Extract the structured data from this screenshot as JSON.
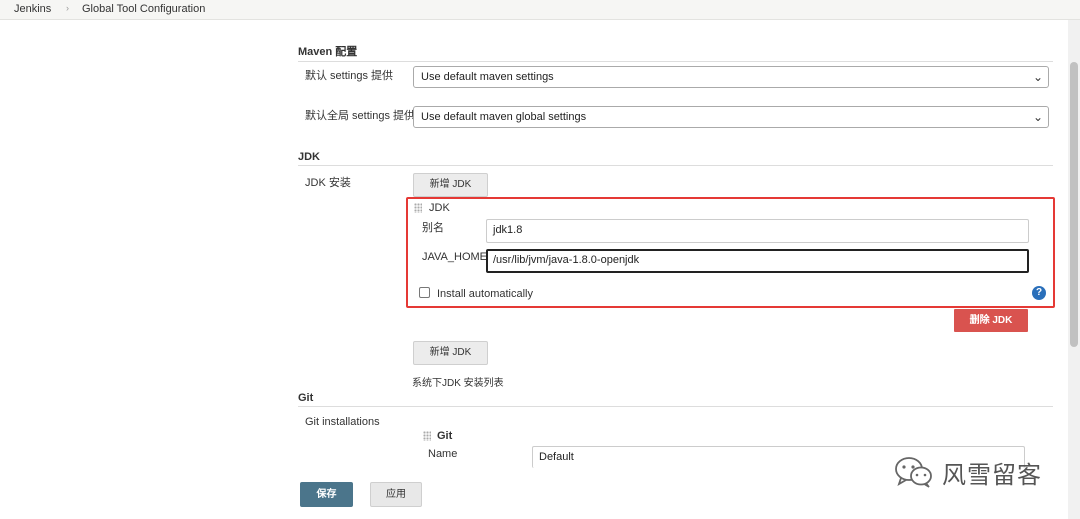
{
  "breadcrumb": {
    "items": [
      "Jenkins",
      "Global Tool Configuration"
    ],
    "separator": "›"
  },
  "maven": {
    "header": "Maven 配置",
    "settings_label": "默认 settings 提供",
    "settings_value": "Use default maven settings",
    "global_label": "默认全局 settings 提供",
    "global_value": "Use default maven global settings"
  },
  "jdk": {
    "header": "JDK",
    "install_label": "JDK 安装",
    "add_button": "新增 JDK",
    "entry": {
      "title": "JDK",
      "alias_label": "别名",
      "alias_value": "jdk1.8",
      "home_label": "JAVA_HOME",
      "home_value": "/usr/lib/jvm/java-1.8.0-openjdk",
      "auto_label": "Install automatically",
      "auto_checked": false,
      "delete_button": "删除 JDK"
    },
    "add_button_2": "新增 JDK",
    "list_note": "系统下JDK 安装列表"
  },
  "git": {
    "header": "Git",
    "installations_label": "Git installations",
    "entry_title": "Git",
    "name_label": "Name",
    "name_value": "Default"
  },
  "footer": {
    "save_label": "保存",
    "apply_label": "应用"
  },
  "watermark": {
    "text": "风雪留客",
    "icon": "wechat-icon"
  },
  "colors": {
    "accent_red": "#e53935",
    "save_blue": "#4b758b",
    "delete_red": "#d9534f",
    "help_blue": "#2a6fba"
  }
}
